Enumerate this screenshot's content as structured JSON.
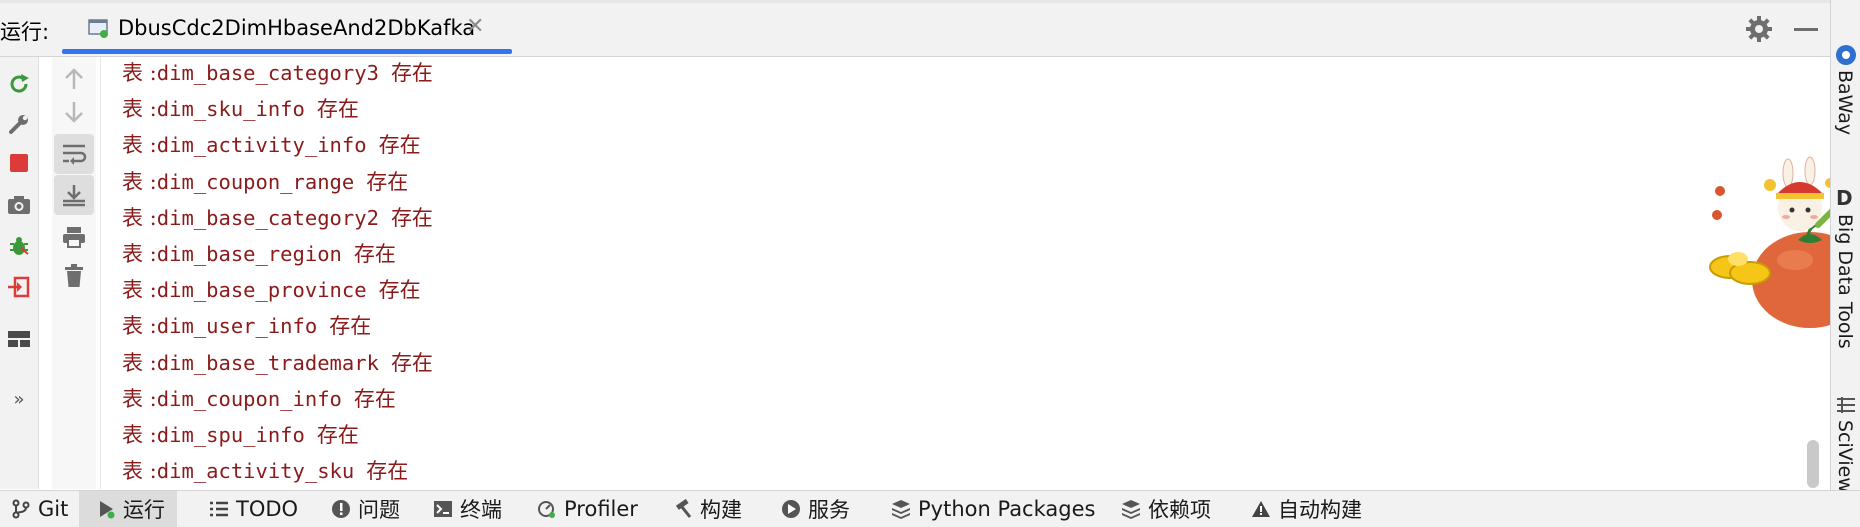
{
  "header": {
    "run_label": "运行:",
    "tab_label": "DbusCdc2DimHbaseAnd2DbKafka",
    "close_glyph": "✕"
  },
  "console": {
    "prefix": "表 :",
    "suffix": "存在",
    "text_color": "#8b1a1a",
    "lines": [
      "dim_base_category3",
      "dim_sku_info",
      "dim_activity_info",
      "dim_coupon_range",
      "dim_base_category2",
      "dim_base_region",
      "dim_base_province",
      "dim_user_info",
      "dim_base_trademark",
      "dim_coupon_info",
      "dim_spu_info",
      "dim_activity_sku"
    ]
  },
  "right_sidebar": {
    "items": [
      "BaWay",
      "Big Data Tools",
      "SciView"
    ]
  },
  "bottom_bar": {
    "tabs": [
      {
        "label": "Git",
        "icon": "git-branch-icon"
      },
      {
        "label": "运行",
        "icon": "run-icon"
      },
      {
        "label": "TODO",
        "icon": "todo-list-icon"
      },
      {
        "label": "问题",
        "icon": "problems-icon"
      },
      {
        "label": "终端",
        "icon": "terminal-icon"
      },
      {
        "label": "Profiler",
        "icon": "profiler-icon"
      },
      {
        "label": "构建",
        "icon": "build-hammer-icon"
      },
      {
        "label": "服务",
        "icon": "services-icon"
      },
      {
        "label": "Python Packages",
        "icon": "python-packages-icon"
      },
      {
        "label": "依赖项",
        "icon": "dependencies-icon"
      },
      {
        "label": "自动构建",
        "icon": "auto-build-warning-icon"
      }
    ],
    "active_index": 1
  },
  "colors": {
    "accent": "#3574f0",
    "rerun_green": "#3a9a3a",
    "stop_red": "#db3b3b",
    "toolbar_bg": "#f2f2f2"
  }
}
